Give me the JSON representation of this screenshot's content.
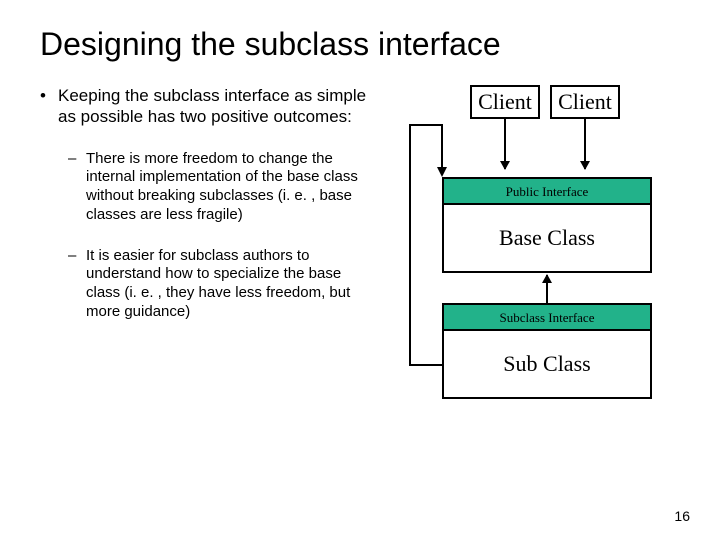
{
  "title": "Designing the subclass interface",
  "bullets": {
    "lv1": "Keeping the subclass interface as simple as possible has two positive outcomes:",
    "lv2a": "There is more freedom to change the internal implementation of the base class without breaking subclasses (i. e. , base classes are less fragile)",
    "lv2b": "It is easier for subclass authors to understand how to specialize the base class (i. e. , they have less freedom, but more guidance)"
  },
  "diagram": {
    "client1": "Client",
    "client2": "Client",
    "public_iface": "Public Interface",
    "base_class": "Base Class",
    "subclass_iface": "Subclass Interface",
    "sub_class": "Sub Class"
  },
  "page": "16"
}
